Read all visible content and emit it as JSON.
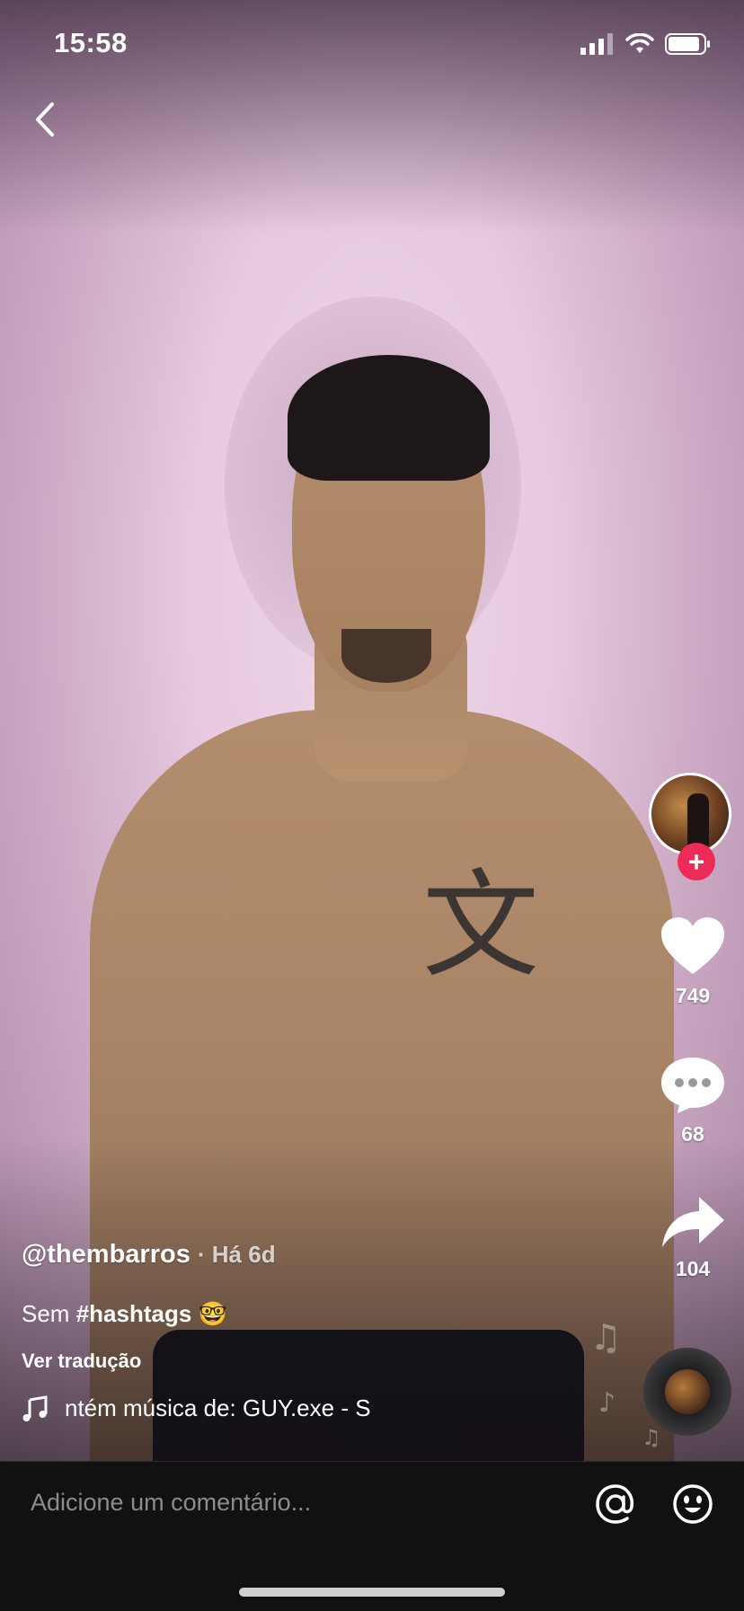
{
  "status_bar": {
    "time": "15:58"
  },
  "video": {
    "username": "@thembarros",
    "time_ago": "· Há 6d",
    "caption_text": "Sem ",
    "caption_hashtag": "#hashtags",
    "caption_emoji": "🤓",
    "translate_label": "Ver tradução",
    "music_text": "ntém música de: GUY.exe - S"
  },
  "actions": {
    "likes": "749",
    "comments": "68",
    "shares": "104",
    "follow_glyph": "+"
  },
  "comment_bar": {
    "placeholder": "Adicione um comentário..."
  },
  "colors": {
    "follow_red": "#ee2b56",
    "bar_bg": "#111111"
  }
}
